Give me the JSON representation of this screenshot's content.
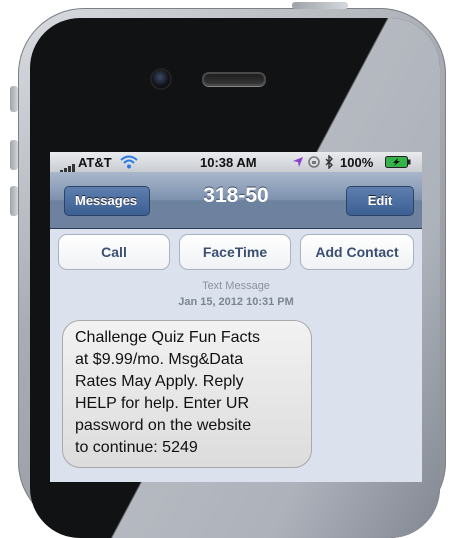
{
  "status_bar": {
    "carrier": "AT&T",
    "time": "10:38 AM",
    "battery": "100%",
    "icons": [
      "signal-bars-icon",
      "wifi-icon",
      "location-arrow-icon",
      "lock-rotation-icon",
      "bluetooth-icon",
      "battery-icon"
    ]
  },
  "nav": {
    "back_label": "Messages",
    "title": "318-50",
    "edit_label": "Edit"
  },
  "actions": {
    "call": "Call",
    "facetime": "FaceTime",
    "add_contact": "Add Contact"
  },
  "thread": {
    "type_label": "Text Message",
    "timestamp": "Jan 15, 2012 10:31 PM",
    "messages": [
      {
        "lines": [
          "Challenge Quiz Fun Facts",
          "at $9.99/mo. Msg&Data",
          "Rates May Apply. Reply",
          "HELP for help. Enter UR",
          "password on the website",
          "to continue: 5249"
        ]
      }
    ]
  },
  "colors": {
    "nav_bar": "#7d91ae",
    "screen_bg": "#dbe2ed",
    "action_text": "#3b4f72",
    "bubble": "#e6e6e6"
  }
}
